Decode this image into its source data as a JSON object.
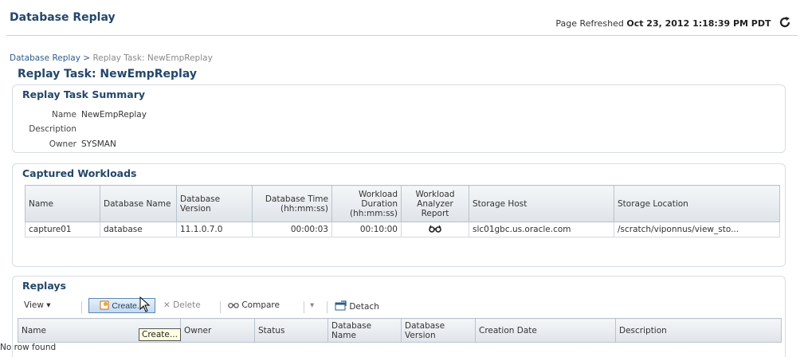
{
  "header": {
    "app_title": "Database Replay",
    "refreshed_label": "Page Refreshed",
    "refreshed_time": "Oct 23, 2012 1:18:39 PM PDT",
    "refresh_icon": "refresh-icon"
  },
  "breadcrumb": {
    "parent": "Database Replay",
    "separator": ">",
    "current": "Replay Task: NewEmpReplay"
  },
  "page_title": "Replay Task: NewEmpReplay",
  "summary": {
    "title": "Replay Task Summary",
    "name_label": "Name",
    "name_value": "NewEmpReplay",
    "description_label": "Description",
    "description_value": "",
    "owner_label": "Owner",
    "owner_value": "SYSMAN"
  },
  "captured": {
    "title": "Captured Workloads",
    "columns": [
      "Name",
      "Database Name",
      "Database Version",
      "Database Time (hh:mm:ss)",
      "Workload Duration (hh:mm:ss)",
      "Workload Analyzer Report",
      "Storage Host",
      "Storage Location"
    ],
    "rows": [
      {
        "name": "capture01",
        "db_name": "database",
        "db_version": "11.1.0.7.0",
        "db_time": "00:00:03",
        "duration": "00:10:00",
        "report_icon": "glasses-icon",
        "host": "slc01gbc.us.oracle.com",
        "location": "/scratch/viponnus/view_sto..."
      }
    ]
  },
  "replays": {
    "title": "Replays",
    "toolbar": {
      "view": "View",
      "create": "Create...",
      "delete": "Delete",
      "compare": "Compare",
      "detach": "Detach"
    },
    "columns": [
      "Name",
      "Owner",
      "Status",
      "Database Name",
      "Database Version",
      "Creation Date",
      "Description"
    ],
    "empty_text": "No row found",
    "tooltip": "Create..."
  },
  "colors": {
    "title_blue": "#23476a",
    "link_blue": "#2c5c8a",
    "header_grad_start": "#f4f6f8",
    "header_grad_end": "#dfe4ea"
  }
}
